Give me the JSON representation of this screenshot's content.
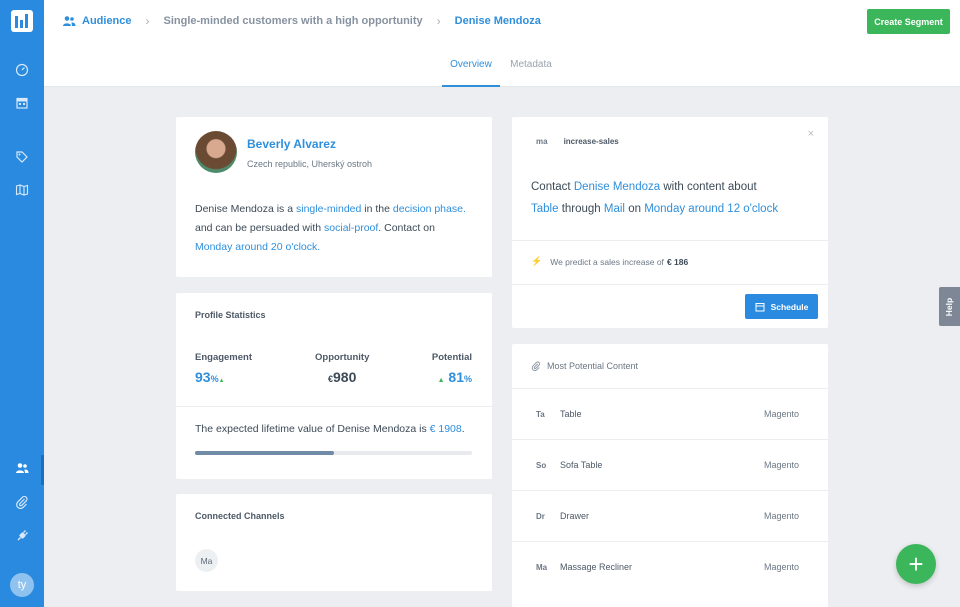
{
  "breadcrumb": {
    "root": "Audience",
    "segment": "Single-minded customers with a high opportunity",
    "current": "Denise Mendoza"
  },
  "header": {
    "create_label": "Create Segment",
    "tabs": [
      {
        "label": "Overview",
        "active": true
      },
      {
        "label": "Metadata",
        "active": false
      }
    ]
  },
  "sidebar": {
    "avatar_initials": "ty",
    "icons": [
      "dashboard-icon",
      "calendar-icon",
      "tags-icon",
      "map-icon",
      "audience-icon",
      "attachment-icon",
      "plug-icon"
    ]
  },
  "profile": {
    "name": "Beverly Alvarez",
    "location": "Czech republic, Uherský ostroh",
    "desc": {
      "subject": "Denise Mendoza",
      "t1": " is a ",
      "trait": "single-minded",
      "t2": " in the ",
      "phase": "decision phase.",
      "t3": " and can be persuaded with ",
      "persuasion": "social-proof",
      "t4": ". Contact on ",
      "time": "Monday around 20 o'clock."
    }
  },
  "stats": {
    "title": "Profile Statistics",
    "engagement_label": "Engagement",
    "engagement_value": "93",
    "engagement_unit": "%",
    "opportunity_label": "Opportunity",
    "opportunity_currency": "€",
    "opportunity_value": "980",
    "potential_label": "Potential",
    "potential_value": "81",
    "potential_unit": "%",
    "lifetime_text": "The expected lifetime value of Denise Mendoza is ",
    "lifetime_value": "€ 1908",
    "lifetime_end": ".",
    "progress": 0.5
  },
  "channels": {
    "title": "Connected Channels",
    "items": [
      "Ma"
    ]
  },
  "recommendation": {
    "abbr": "ma",
    "tag": "increase-sales",
    "close": "×",
    "t1": "Contact ",
    "person": "Denise Mendoza",
    "t2": " with content about",
    "content": "Table",
    "t3": " through ",
    "channel": "Mail",
    "t4": " on ",
    "time": "Monday around 12 o'clock",
    "predict_text": "We predict a sales increase of",
    "predict_value": "€ 186",
    "schedule_label": "Schedule"
  },
  "content": {
    "title": "Most Potential Content",
    "rows": [
      {
        "abbr": "Ta",
        "name": "Table",
        "source": "Magento"
      },
      {
        "abbr": "So",
        "name": "Sofa Table",
        "source": "Magento"
      },
      {
        "abbr": "Dr",
        "name": "Drawer",
        "source": "Magento"
      },
      {
        "abbr": "Ma",
        "name": "Massage Recliner",
        "source": "Magento"
      }
    ]
  },
  "help_label": "Help",
  "colors": {
    "primary": "#2a8adf",
    "success": "#3cb65a",
    "link": "#2f8fdb"
  }
}
